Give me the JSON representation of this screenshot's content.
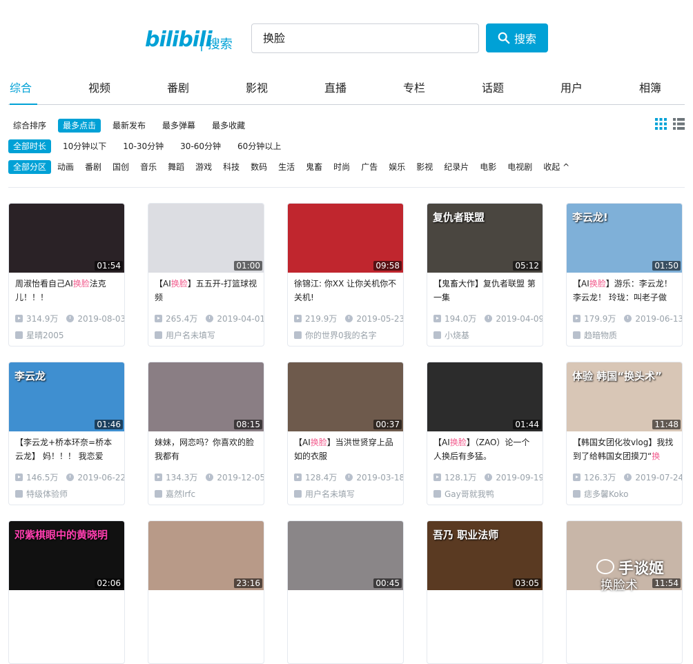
{
  "header": {
    "logo": "bilibili",
    "section": "| 搜索",
    "search_value": "换脸",
    "search_button": "搜索"
  },
  "tabs": [
    "综合",
    "视频",
    "番剧",
    "影视",
    "直播",
    "专栏",
    "话题",
    "用户",
    "相簿"
  ],
  "active_tab": "综合",
  "sort_filters": [
    "综合排序",
    "最多点击",
    "最新发布",
    "最多弹幕",
    "最多收藏"
  ],
  "active_sort": "最多点击",
  "duration_filters": [
    "全部时长",
    "10分钟以下",
    "10-30分钟",
    "30-60分钟",
    "60分钟以上"
  ],
  "zone_filters": [
    "全部分区",
    "动画",
    "番剧",
    "国创",
    "音乐",
    "舞蹈",
    "游戏",
    "科技",
    "数码",
    "生活",
    "鬼畜",
    "时尚",
    "广告",
    "娱乐",
    "影视",
    "纪录片",
    "电影",
    "电视剧",
    "收起 ^"
  ],
  "view_icons": [
    "grid-view-icon",
    "list-view-icon"
  ],
  "colors": {
    "accent": "#00a1d6",
    "highlight": "#f25d8e",
    "meta": "#99a2aa"
  },
  "videos": [
    {
      "duration": "01:54",
      "title_pre": "周淑怡看自己AI",
      "title_hl": "换脸",
      "title_post": "法克儿！！！",
      "views": "314.9万",
      "date": "2019-08-03",
      "uploader": "星晴2005",
      "thumb": "#2a2226",
      "thumb_text": ""
    },
    {
      "duration": "01:00",
      "title_pre": "【AI",
      "title_hl": "换脸",
      "title_post": "】五五开-打篮球视频",
      "views": "265.4万",
      "date": "2019-04-01",
      "uploader": "用户名未填写",
      "thumb": "#dcdde2",
      "thumb_text": ""
    },
    {
      "duration": "09:58",
      "title_pre": "徐锦江: 你XX 让你关机你不关机!",
      "title_hl": "",
      "title_post": "",
      "views": "219.9万",
      "date": "2019-05-23",
      "uploader": "你的世界0我的名字",
      "thumb": "#c0262e",
      "thumb_text": ""
    },
    {
      "duration": "05:12",
      "title_pre": "【鬼畜大作】复仇者联盟 第一集",
      "title_hl": "",
      "title_post": "",
      "views": "194.0万",
      "date": "2019-04-09",
      "uploader": "小烧基",
      "thumb": "#4a4640",
      "thumb_text": "复仇者联盟"
    },
    {
      "duration": "01:50",
      "title_pre": "【AI",
      "title_hl": "换脸",
      "title_post": "】游乐：李云龙！李云龙！ 玲珑：叫老子做",
      "views": "179.9万",
      "date": "2019-06-13",
      "uploader": "趋暗物质",
      "thumb": "#7fb0d8",
      "thumb_text": "李云龙!"
    },
    {
      "duration": "01:46",
      "title_pre": "【李云龙+桥本环奈=桥本云龙】 妈！！！ 我恋爱了!!!!!!!",
      "title_hl": "",
      "title_post": "",
      "views": "146.5万",
      "date": "2019-06-22",
      "uploader": "特级体验师",
      "thumb": "#3f8fd0",
      "thumb_text": "李云龙"
    },
    {
      "duration": "08:15",
      "title_pre": "妹妹，网恋吗？你喜欢的脸我都有",
      "title_hl": "",
      "title_post": "",
      "views": "134.3万",
      "date": "2019-12-05",
      "uploader": "嘉然lrfc",
      "thumb": "#8a7e84",
      "thumb_text": ""
    },
    {
      "duration": "00:37",
      "title_pre": "【AI",
      "title_hl": "换脸",
      "title_post": "】当洪世贤穿上品如的衣服",
      "views": "128.4万",
      "date": "2019-03-18",
      "uploader": "用户名未填写",
      "thumb": "#6e5a4c",
      "thumb_text": ""
    },
    {
      "duration": "01:44",
      "title_pre": "【AI",
      "title_hl": "换脸",
      "title_post": "】（ZAO）论一个人换后有多猛。",
      "views": "128.1万",
      "date": "2019-09-19",
      "uploader": "Gay哥就我鸭",
      "thumb": "#2c2c2c",
      "thumb_text": ""
    },
    {
      "duration": "11:48",
      "title_pre": "【韩国女团化妆vlog】我找到了给韩国女团摸刀“",
      "title_hl": "换",
      "title_post": "",
      "views": "126.3万",
      "date": "2019-07-24",
      "uploader": "痣多馨Koko",
      "thumb": "#d8c6b6",
      "thumb_text": "体验 韩国“换头术”"
    },
    {
      "duration": "02:06",
      "title_pre": "",
      "title_hl": "",
      "title_post": "",
      "views": "",
      "date": "",
      "uploader": "",
      "thumb": "#111111",
      "thumb_text": "邓紫棋眼中的黄晓明"
    },
    {
      "duration": "23:16",
      "title_pre": "",
      "title_hl": "",
      "title_post": "",
      "views": "",
      "date": "",
      "uploader": "",
      "thumb": "#b89a88",
      "thumb_text": ""
    },
    {
      "duration": "00:45",
      "title_pre": "",
      "title_hl": "",
      "title_post": "",
      "views": "",
      "date": "",
      "uploader": "",
      "thumb": "#8a8688",
      "thumb_text": ""
    },
    {
      "duration": "03:05",
      "title_pre": "",
      "title_hl": "",
      "title_post": "",
      "views": "",
      "date": "",
      "uploader": "",
      "thumb": "#5a3a22",
      "thumb_text": "吾乃 职业法师"
    },
    {
      "duration": "11:54",
      "title_pre": "",
      "title_hl": "",
      "title_post": "",
      "views": "",
      "date": "",
      "uploader": "",
      "thumb": "#c8b6a8",
      "thumb_text": ""
    }
  ],
  "watermark": {
    "main": "手谈姬",
    "sub": "换脸术"
  }
}
